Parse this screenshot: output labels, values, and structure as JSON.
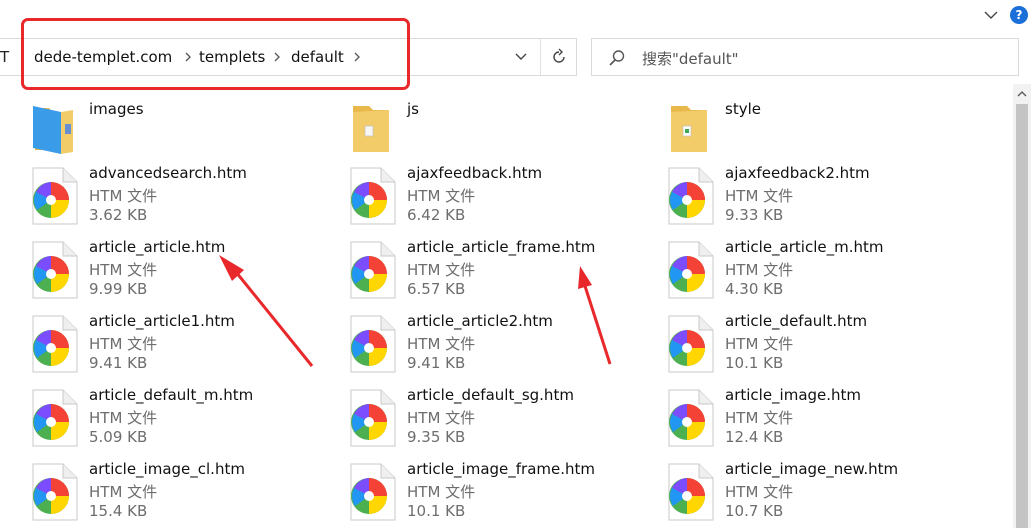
{
  "window": {
    "help_label": "?"
  },
  "address_bar": {
    "truncated_prefix": "T",
    "crumbs": [
      "dede-templet.com",
      "templets",
      "default"
    ]
  },
  "search": {
    "placeholder": "搜索\"default\""
  },
  "folders": [
    {
      "name": "images",
      "icon": "blue-folder-icon"
    },
    {
      "name": "js",
      "icon": "folder-icon"
    },
    {
      "name": "style",
      "icon": "folder-icon"
    }
  ],
  "files": [
    {
      "name": "advancedsearch.htm",
      "type": "HTM 文件",
      "size": "3.62 KB"
    },
    {
      "name": "ajaxfeedback.htm",
      "type": "HTM 文件",
      "size": "6.42 KB"
    },
    {
      "name": "ajaxfeedback2.htm",
      "type": "HTM 文件",
      "size": "9.33 KB"
    },
    {
      "name": "article_article.htm",
      "type": "HTM 文件",
      "size": "9.99 KB"
    },
    {
      "name": "article_article_frame.htm",
      "type": "HTM 文件",
      "size": "6.57 KB"
    },
    {
      "name": "article_article_m.htm",
      "type": "HTM 文件",
      "size": "4.30 KB"
    },
    {
      "name": "article_article1.htm",
      "type": "HTM 文件",
      "size": "9.41 KB"
    },
    {
      "name": "article_article2.htm",
      "type": "HTM 文件",
      "size": "9.41 KB"
    },
    {
      "name": "article_default.htm",
      "type": "HTM 文件",
      "size": "10.1 KB"
    },
    {
      "name": "article_default_m.htm",
      "type": "HTM 文件",
      "size": "5.09 KB"
    },
    {
      "name": "article_default_sg.htm",
      "type": "HTM 文件",
      "size": "9.35 KB"
    },
    {
      "name": "article_image.htm",
      "type": "HTM 文件",
      "size": "12.4 KB"
    },
    {
      "name": "article_image_cl.htm",
      "type": "HTM 文件",
      "size": "15.4 KB"
    },
    {
      "name": "article_image_frame.htm",
      "type": "HTM 文件",
      "size": "10.1 KB"
    },
    {
      "name": "article_image_new.htm",
      "type": "HTM 文件",
      "size": "10.7 KB"
    }
  ],
  "colors": {
    "annotation": "#e8282a",
    "accent": "#1a6fd8"
  }
}
